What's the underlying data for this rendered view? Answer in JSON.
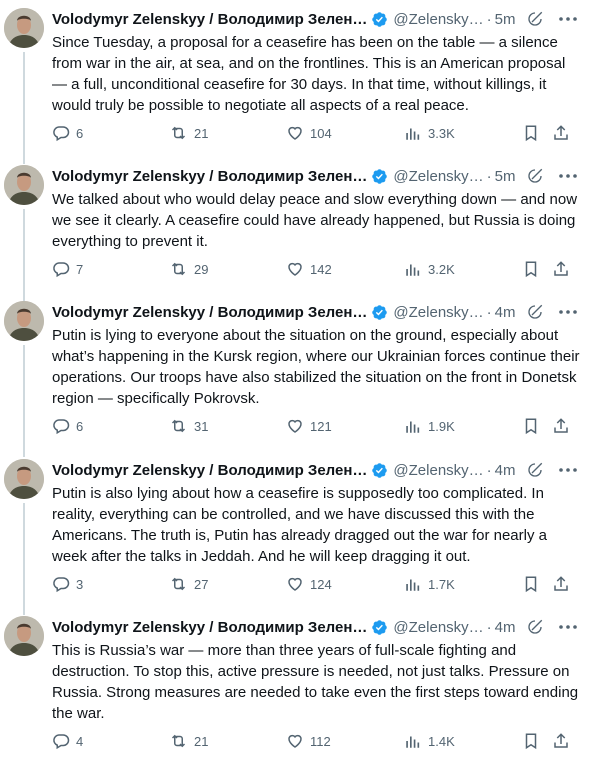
{
  "colors": {
    "text": "#0f1419",
    "muted": "#536471",
    "verified": "#1d9bf0",
    "thread_line": "#cfd9de"
  },
  "icons": {
    "reply": "reply-icon",
    "retweet": "retweet-icon",
    "like": "like-icon",
    "views": "views-icon",
    "bookmark": "bookmark-icon",
    "share": "share-icon",
    "grok": "grok-icon",
    "more": "more-icon",
    "verified": "verified-badge-icon"
  },
  "tweets": [
    {
      "author": "Volodymyr Zelenskyy / Володимир Зеленський",
      "author_shown": "Volodymyr Zelenskyy / Володимир Зелен…",
      "handle": "@Zelensky…",
      "dot": "·",
      "time": "5m",
      "text": "Since Tuesday, a proposal for a ceasefire has been on the table — a silence from war in the air, at sea, and on the frontlines. This is an American proposal — a full, unconditional ceasefire for 30 days. In that time, without killings, it would truly be possible to negotiate all aspects of a real peace.",
      "replies": "6",
      "reposts": "21",
      "likes": "104",
      "views": "3.3K"
    },
    {
      "author": "Volodymyr Zelenskyy / Володимир Зеленський",
      "author_shown": "Volodymyr Zelenskyy / Володимир Зелен…",
      "handle": "@Zelensky…",
      "dot": "·",
      "time": "5m",
      "text": "We talked about who would delay peace and slow everything down — and now we see it clearly. A ceasefire could have already happened, but Russia is doing everything to prevent it.",
      "replies": "7",
      "reposts": "29",
      "likes": "142",
      "views": "3.2K"
    },
    {
      "author": "Volodymyr Zelenskyy / Володимир Зеленський",
      "author_shown": "Volodymyr Zelenskyy / Володимир Зелен…",
      "handle": "@Zelensky…",
      "dot": "·",
      "time": "4m",
      "text": "Putin is lying to everyone about the situation on the ground, especially about what’s happening in the Kursk region, where our Ukrainian forces continue their operations. Our troops have also stabilized the situation on the front in Donetsk region — specifically Pokrovsk.",
      "replies": "6",
      "reposts": "31",
      "likes": "121",
      "views": "1.9K"
    },
    {
      "author": "Volodymyr Zelenskyy / Володимир Зеленський",
      "author_shown": "Volodymyr Zelenskyy / Володимир Зелен…",
      "handle": "@Zelensky…",
      "dot": "·",
      "time": "4m",
      "text": "Putin is also lying about how a ceasefire is supposedly too complicated. In reality, everything can be controlled, and we have discussed this with the Americans. The truth is, Putin has already dragged out the war for nearly a week after the talks in Jeddah. And he will keep dragging it out.",
      "replies": "3",
      "reposts": "27",
      "likes": "124",
      "views": "1.7K"
    },
    {
      "author": "Volodymyr Zelenskyy / Володимир Зеленський",
      "author_shown": "Volodymyr Zelenskyy / Володимир Зелен…",
      "handle": "@Zelensky…",
      "dot": "·",
      "time": "4m",
      "text": "This is Russia’s war — more than three years of full-scale fighting and destruction. To stop this, active pressure is needed, not just talks. Pressure on Russia. Strong measures are needed to take even the first steps toward ending the war.",
      "replies": "4",
      "reposts": "21",
      "likes": "112",
      "views": "1.4K"
    }
  ]
}
